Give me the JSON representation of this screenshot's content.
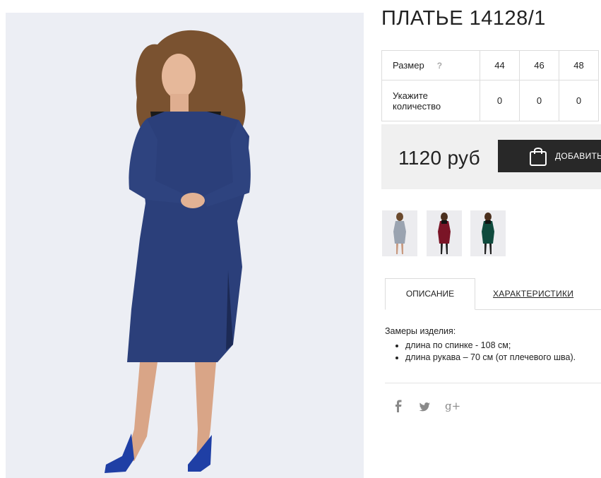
{
  "product": {
    "title": "ПЛАТЬЕ 14128/1",
    "price": "1120 руб",
    "add_to_cart_label": "ДОБАВИТЬ В КОРЗИНУ"
  },
  "size_table": {
    "size_label": "Размер",
    "help_mark": "?",
    "sizes": [
      "44",
      "46",
      "48"
    ],
    "quantity_label_line1": "Укажите",
    "quantity_label_line2": "количество",
    "quantities": [
      "0",
      "0",
      "0"
    ]
  },
  "thumbnails": [
    {
      "color_name": "grey",
      "dress_color": "#9aa3b0"
    },
    {
      "color_name": "burgundy",
      "dress_color": "#7a1426"
    },
    {
      "color_name": "green",
      "dress_color": "#0f4a3d"
    }
  ],
  "tabs": {
    "description": "ОПИСАНИЕ",
    "characteristics": "ХАРАКТЕРИСТИКИ"
  },
  "description": {
    "heading": "Замеры изделия:",
    "items": [
      "длина по спинке - 108 см;",
      "длина рукава – 70 см (от плечевого шва)."
    ]
  },
  "social": {
    "facebook": "f",
    "twitter": "twitter-icon",
    "google_plus": "g+"
  },
  "colors": {
    "dress_main": "#2b3f7a",
    "button_bg": "#282828",
    "price_bg": "#f0f0f0"
  }
}
